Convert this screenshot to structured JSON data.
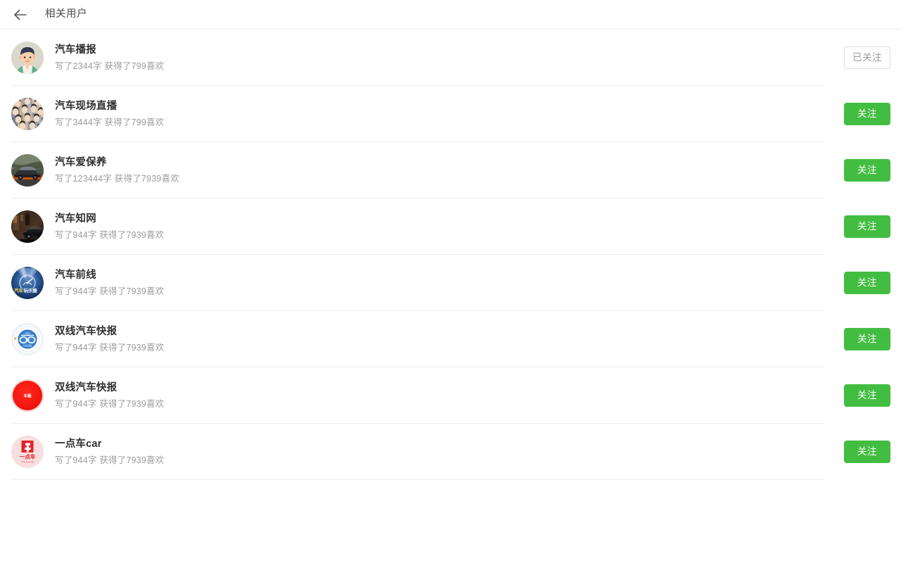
{
  "header": {
    "back_icon": "arrow-left-icon",
    "title": "相关用户"
  },
  "colors": {
    "follow_green": "#42bd41",
    "divider": "#ededed",
    "name_text": "#2f2f2f",
    "stat_text": "#9b9b9b",
    "following_border": "#dcdcdc"
  },
  "buttons": {
    "follow_label": "关注",
    "following_label": "已关注"
  },
  "users": [
    {
      "name": "汽车播报",
      "stats": "写了2344字 获得了799喜欢",
      "avatar": "cartoon-man-avatar",
      "followed": true,
      "action_label": "已关注"
    },
    {
      "name": "汽车现场直播",
      "stats": "写了3444字 获得了799喜欢",
      "avatar": "face-collage-avatar",
      "followed": false,
      "action_label": "关注"
    },
    {
      "name": "汽车爱保养",
      "stats": "写了123444字 获得了7939喜欢",
      "avatar": "sports-car-photo-avatar",
      "followed": false,
      "action_label": "关注"
    },
    {
      "name": "汽车知网",
      "stats": "写了944字 获得了7939喜欢",
      "avatar": "dark-car-photo-avatar",
      "followed": false,
      "action_label": "关注"
    },
    {
      "name": "汽车前线",
      "stats": "写了944字 获得了7939喜欢",
      "avatar": "blue-gauge-logo-avatar",
      "followed": false,
      "action_label": "关注"
    },
    {
      "name": "双线汽车快报",
      "stats": "写了944字 获得了7939喜欢",
      "avatar": "blue-seal-logo-avatar",
      "followed": false,
      "action_label": "关注"
    },
    {
      "name": "双线汽车快报",
      "stats": "写了944字 获得了7939喜欢",
      "avatar": "red-circle-logo-avatar",
      "followed": false,
      "action_label": "关注"
    },
    {
      "name": "一点车car",
      "stats": "写了944字 获得了7939喜欢",
      "avatar": "yidianche-logo-avatar",
      "followed": false,
      "action_label": "关注"
    }
  ]
}
